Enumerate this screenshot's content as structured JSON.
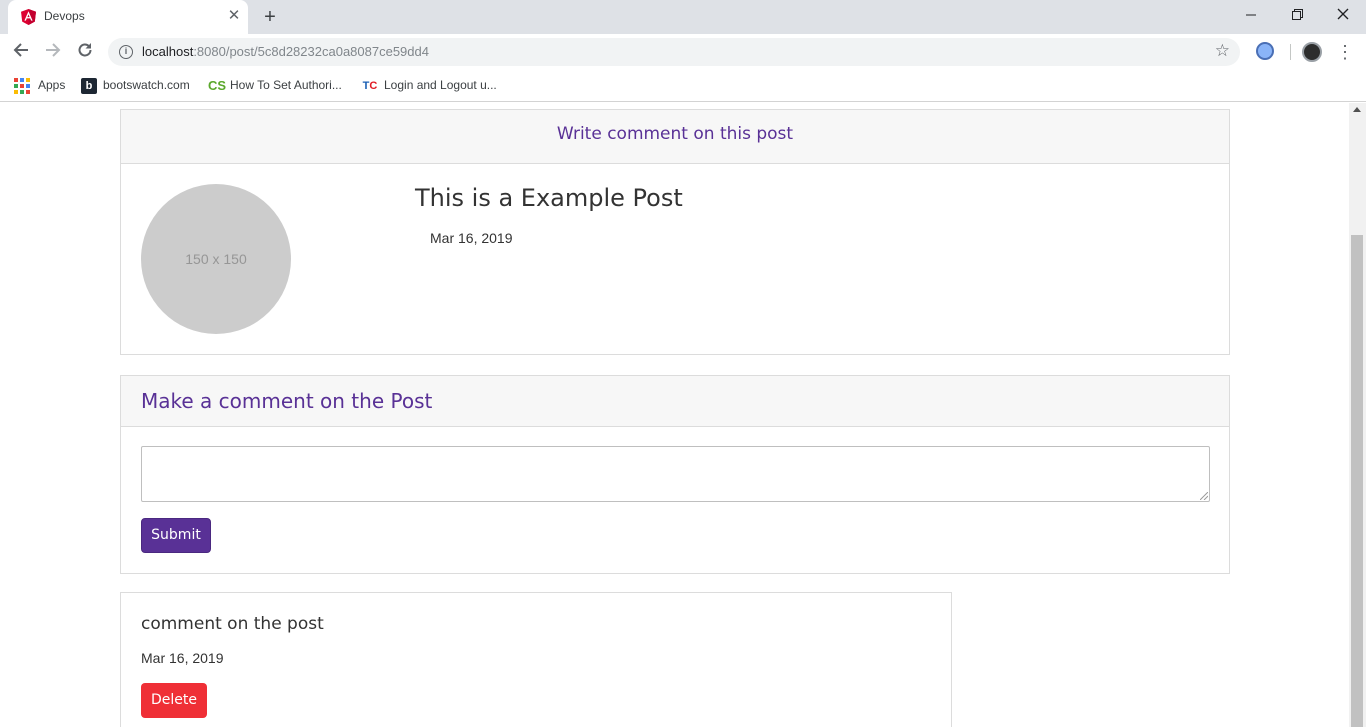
{
  "browser": {
    "tab_title": "Devops",
    "new_tab_icon": "plus-icon",
    "url_host": "localhost",
    "url_rest": ":8080/post/5c8d28232ca0a8087ce59dd4",
    "window_controls": [
      "minimize",
      "restore",
      "close"
    ]
  },
  "bookmarks": [
    {
      "label": "Apps",
      "icon": "apps-grid-icon"
    },
    {
      "label": "bootswatch.com",
      "icon": "b"
    },
    {
      "label": "How To Set Authori...",
      "icon": "CS"
    },
    {
      "label": "Login and Logout u...",
      "icon": "TC"
    }
  ],
  "post_card": {
    "header": "Write comment on this post",
    "thumbnail_text": "150 x 150",
    "title": "This is a Example Post",
    "date": "Mar 16, 2019"
  },
  "comment_form": {
    "header": "Make a comment on the Post",
    "textarea_value": "",
    "submit_label": "Submit"
  },
  "comments": [
    {
      "text": "comment on the post",
      "date": "Mar 16, 2019",
      "delete_label": "Delete"
    }
  ],
  "colors": {
    "brand_primary": "#593196",
    "danger": "#ef2f36",
    "header_bg": "#f7f7f7"
  }
}
